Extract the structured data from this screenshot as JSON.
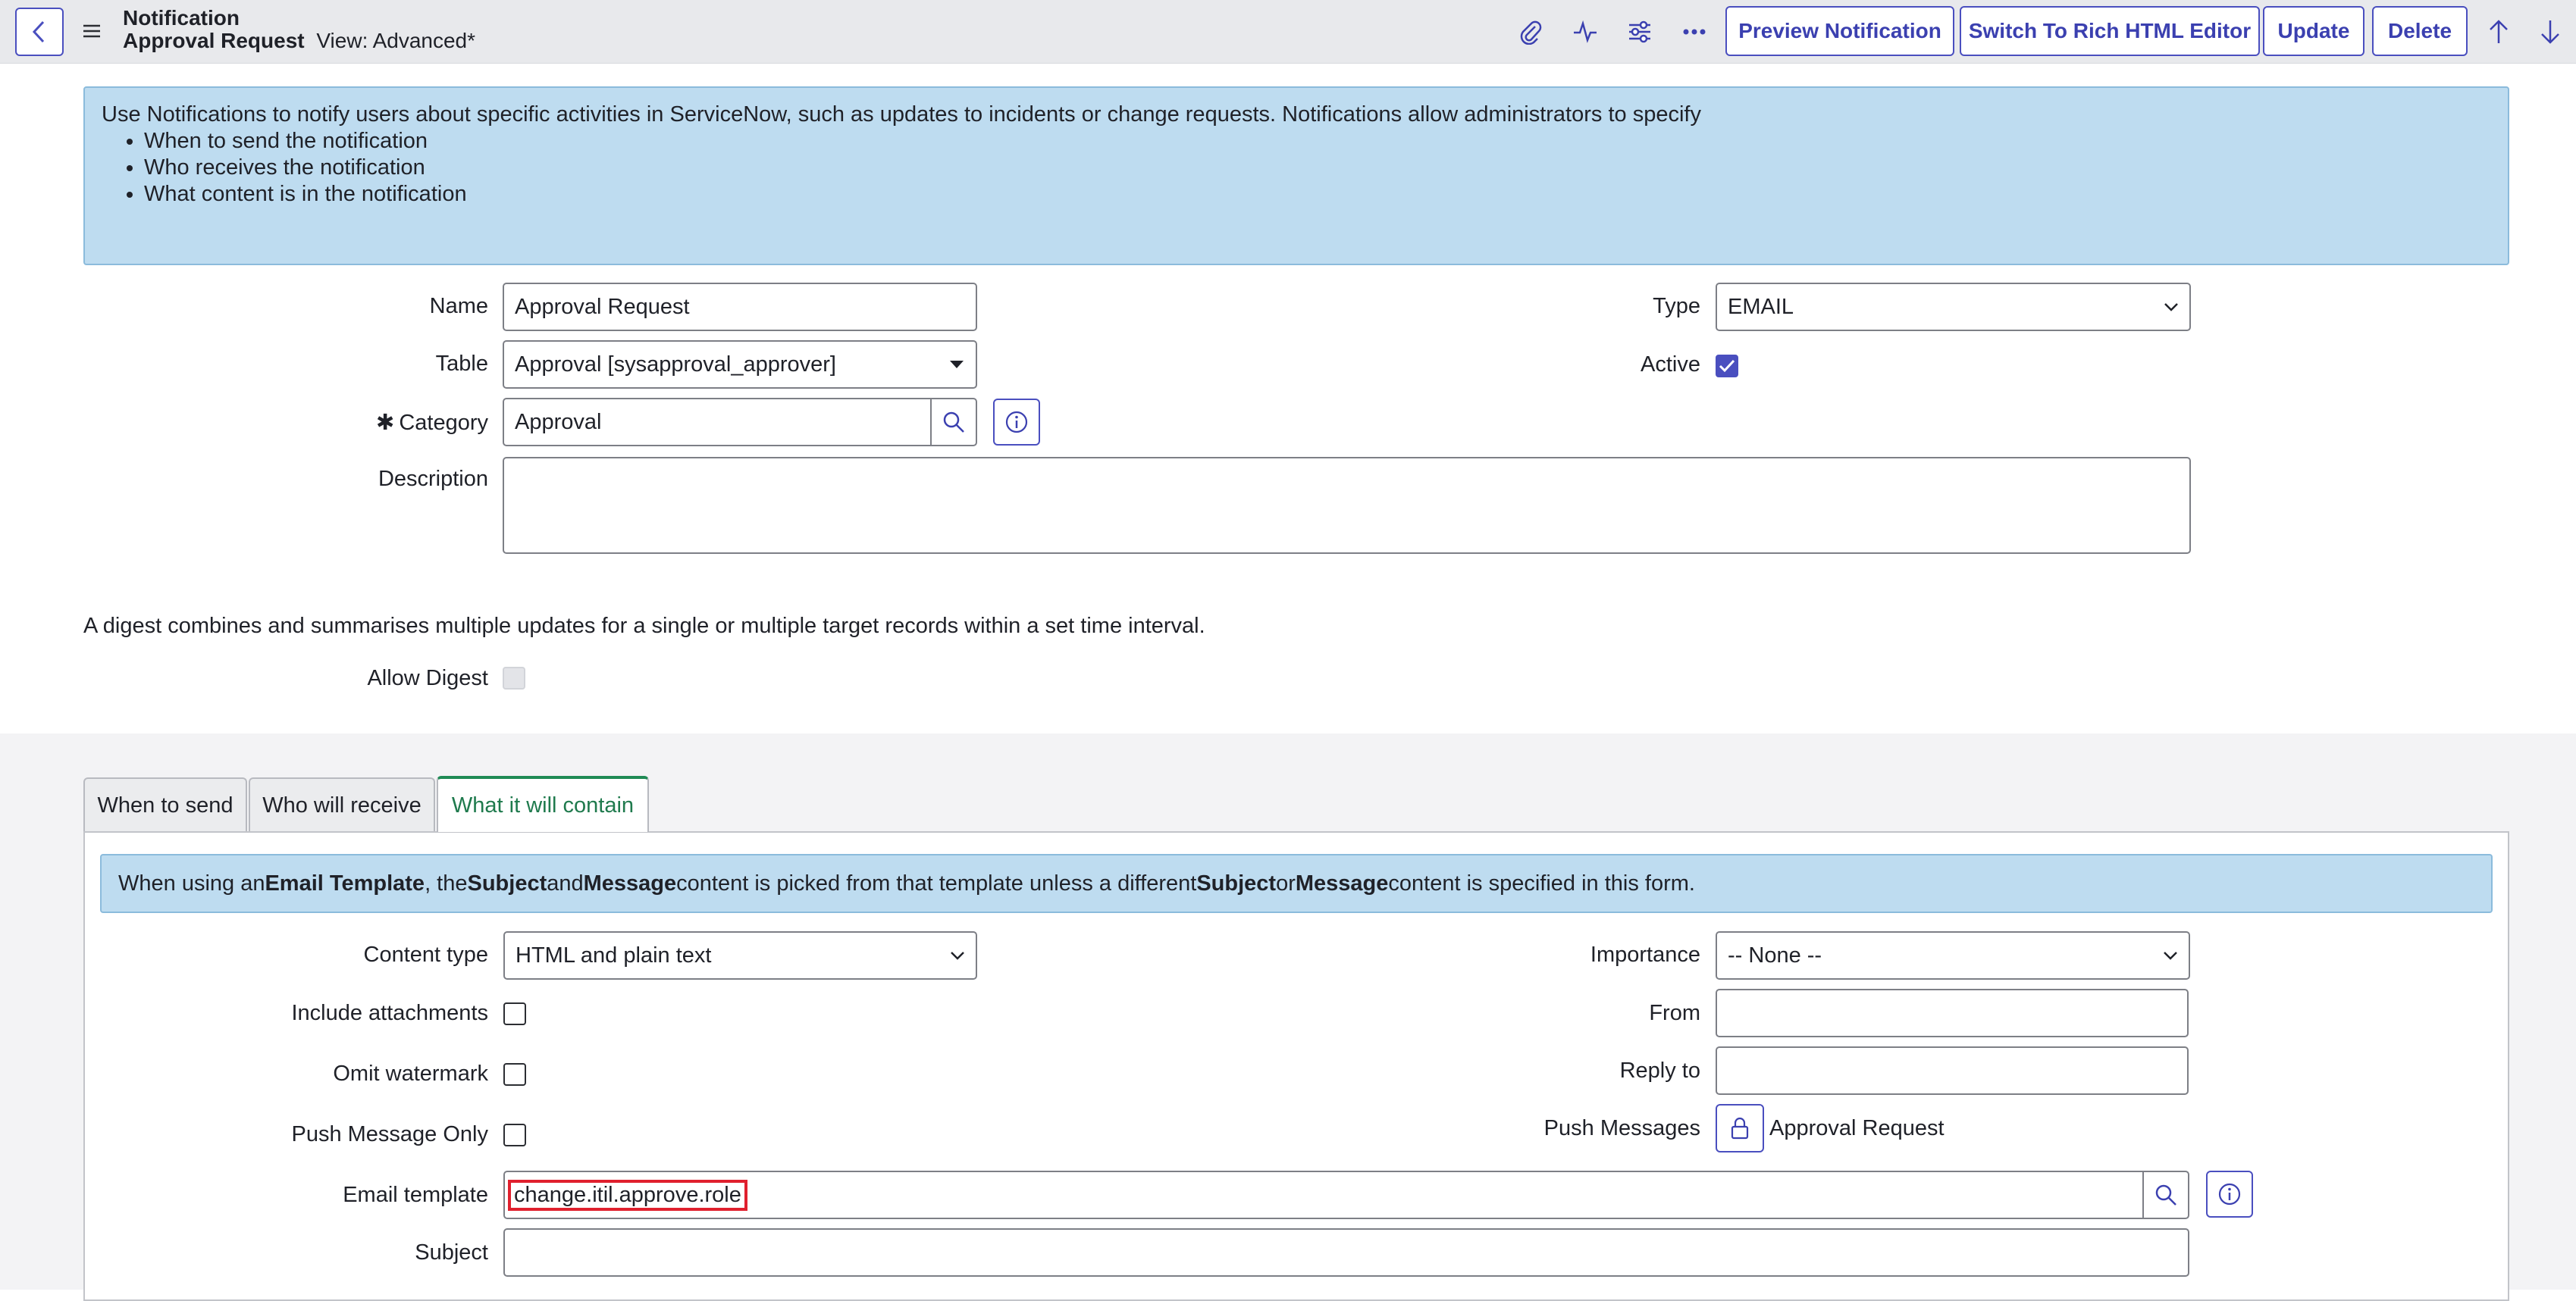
{
  "header": {
    "record_type": "Notification",
    "record_name": "Approval Request",
    "view_label": "View: Advanced*",
    "buttons": {
      "preview": "Preview Notification",
      "rich_editor": "Switch To Rich HTML Editor",
      "update": "Update",
      "delete": "Delete"
    }
  },
  "info": {
    "intro": "Use Notifications to notify users about specific activities in ServiceNow, such as updates to incidents or change requests. Notifications allow administrators to specify",
    "bullets": [
      "When to send the notification",
      "Who receives the notification",
      "What content is in the notification"
    ]
  },
  "form": {
    "name_label": "Name",
    "name_value": "Approval Request",
    "table_label": "Table",
    "table_value": "Approval [sysapproval_approver]",
    "category_required": "✱",
    "category_label": "Category",
    "category_value": "Approval",
    "description_label": "Description",
    "description_value": "",
    "type_label": "Type",
    "type_value": "EMAIL",
    "active_label": "Active",
    "active_checked": true,
    "digest_text": "A digest combines and summarises multiple updates for a single or multiple target records within a set time interval.",
    "allow_digest_label": "Allow Digest"
  },
  "tabs": [
    "When to send",
    "Who will receive",
    "What it will contain"
  ],
  "content": {
    "notice_parts": [
      "When using an ",
      "Email Template",
      ", the ",
      "Subject",
      " and ",
      "Message",
      " content is picked from that template unless a different ",
      "Subject",
      " or ",
      "Message",
      " content is specified in this form."
    ],
    "content_type_label": "Content type",
    "content_type_value": "HTML and plain text",
    "include_attachments_label": "Include attachments",
    "omit_watermark_label": "Omit watermark",
    "push_only_label": "Push Message Only",
    "email_template_label": "Email template",
    "email_template_value": "change.itil.approve.role",
    "subject_label": "Subject",
    "subject_value": "",
    "importance_label": "Importance",
    "importance_value": "-- None --",
    "from_label": "From",
    "from_value": "",
    "reply_to_label": "Reply to",
    "reply_to_value": "",
    "push_messages_label": "Push Messages",
    "push_messages_value": "Approval Request"
  },
  "colors": {
    "accent": "#4a4fbf",
    "info_bg": "#bedcf0",
    "active_tab": "#1f8a55",
    "highlight": "#e0202e"
  }
}
